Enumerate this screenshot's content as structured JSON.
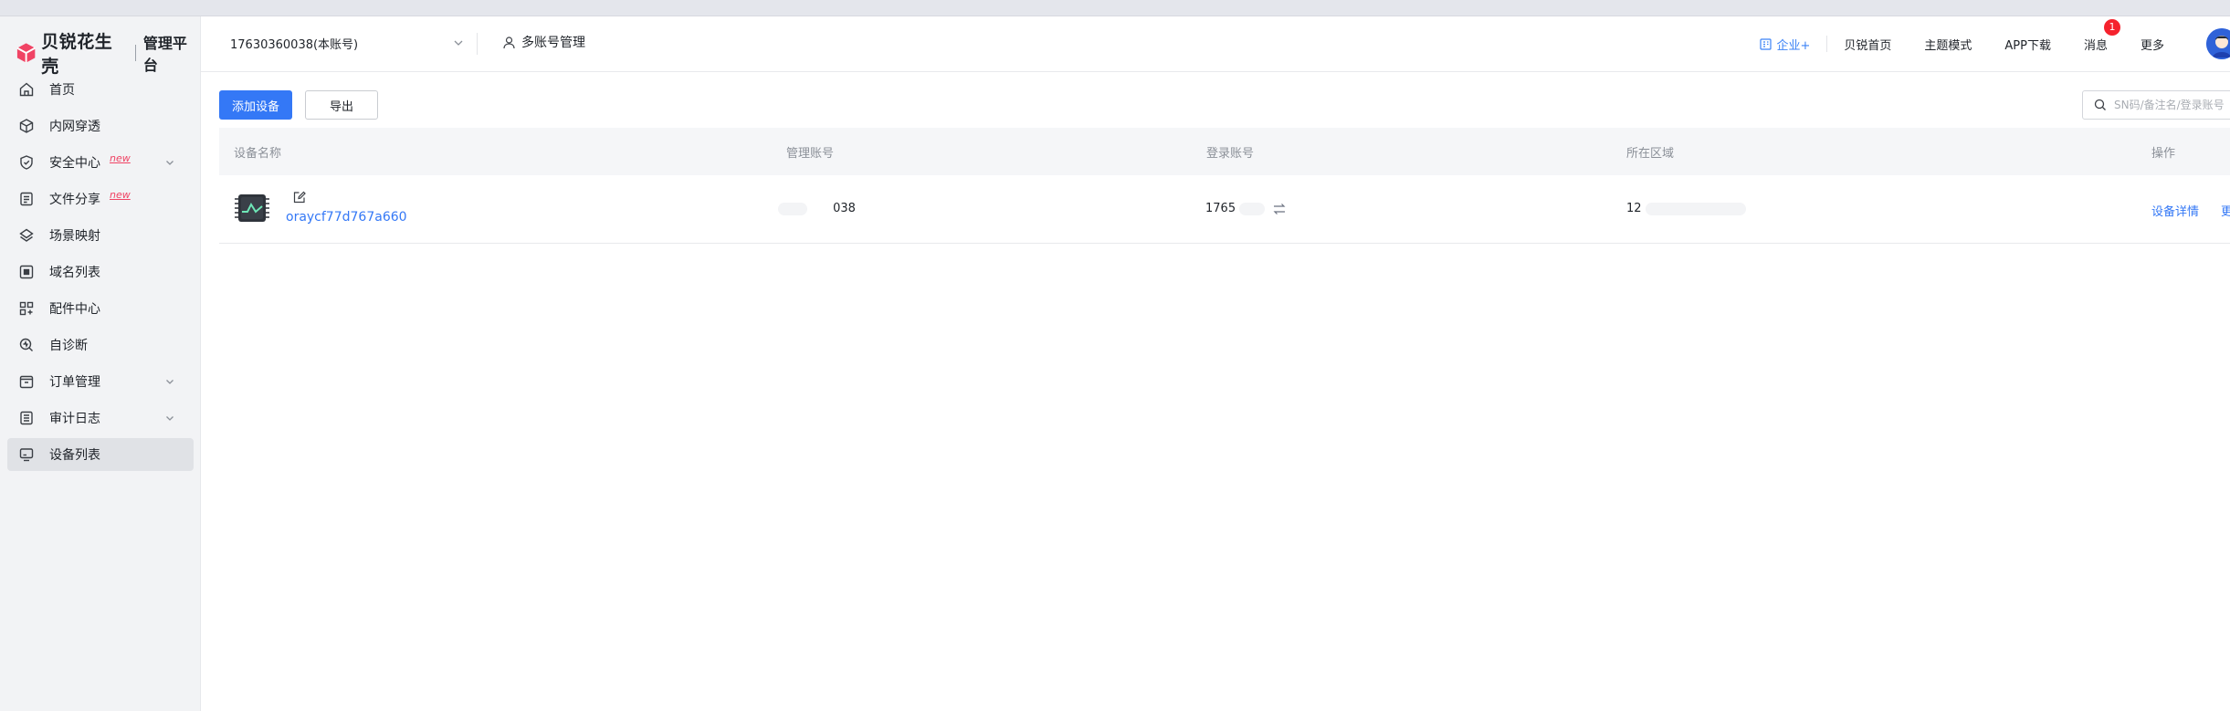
{
  "brand": {
    "name": "贝锐花生壳",
    "subtitle": "管理平台",
    "accent": "#f04364"
  },
  "sidebar": {
    "items": [
      {
        "label": "首页",
        "icon": "home-icon"
      },
      {
        "label": "内网穿透",
        "icon": "cube-icon"
      },
      {
        "label": "安全中心",
        "icon": "shield-icon",
        "badge": "new",
        "expandable": true
      },
      {
        "label": "文件分享",
        "icon": "file-share-icon",
        "badge": "new"
      },
      {
        "label": "场景映射",
        "icon": "scene-icon"
      },
      {
        "label": "域名列表",
        "icon": "domain-icon"
      },
      {
        "label": "配件中心",
        "icon": "grid-icon"
      },
      {
        "label": "自诊断",
        "icon": "diagnose-icon"
      },
      {
        "label": "订单管理",
        "icon": "order-icon",
        "expandable": true
      },
      {
        "label": "审计日志",
        "icon": "log-icon",
        "expandable": true
      },
      {
        "label": "设备列表",
        "icon": "device-list-icon",
        "active": true
      }
    ]
  },
  "header": {
    "account": "17630360038(本账号)",
    "multi_account": "多账号管理",
    "enterprise": "企业+",
    "home": "贝锐首页",
    "theme": "主题模式",
    "app_download": "APP下载",
    "messages": "消息",
    "message_count": "1",
    "more": "更多"
  },
  "toolbar": {
    "add_device": "添加设备",
    "export": "导出",
    "search_placeholder": "SN码/备注名/登录账号"
  },
  "table": {
    "columns": [
      "设备名称",
      "管理账号",
      "登录账号",
      "所在区域",
      "操作"
    ],
    "rows": [
      {
        "device_name": "oraycf77d767a660",
        "manage_account": "038",
        "login_account": "1765",
        "region": "12",
        "actions": [
          "设备详情",
          "更"
        ]
      }
    ]
  }
}
